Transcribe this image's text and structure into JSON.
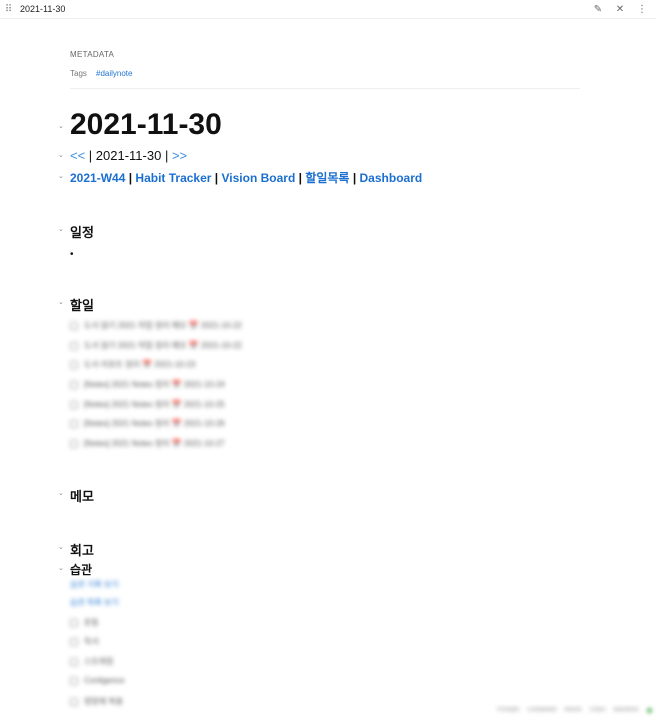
{
  "tab": {
    "title": "2021-11-30"
  },
  "metadata": {
    "title": "METADATA",
    "tags_label": "Tags",
    "tag": "#dailynote"
  },
  "page": {
    "title": "2021-11-30",
    "nav": {
      "prev": "<<",
      "sep1": " | ",
      "current": "2021-11-30",
      "sep2": " | ",
      "next": ">>"
    },
    "links": [
      "2021-W44",
      "Habit Tracker",
      "Vision Board",
      "할일목록",
      "Dashboard"
    ],
    "link_sep": " | "
  },
  "sections": {
    "schedule": "일정",
    "schedule_bullet": "•",
    "todo": "할일",
    "memo": "메모",
    "review": "회고",
    "habit": "습관"
  },
  "todo_items": [
    "도서 읽기 2021 작업 정리 메모 📅 2021-10-22",
    "도서 읽기 2021 작업 정리 메모 📅 2021-10-22",
    "도서 리포트 정리 📅 2021-10-23",
    "[Notes] 2021 Notes 정리 📅 2021-10-24",
    "[Notes] 2021 Notes 정리 📅 2021-10-25",
    "[Notes] 2021 Notes 정리 📅 2021-10-26",
    "[Notes] 2021 Notes 정리 📅 2021-10-27"
  ],
  "habit_links": [
    "습관 기록 보기",
    "습관 목록 보기"
  ],
  "habit_items": [
    "운동",
    "독서",
    "스트레칭",
    "Contigence",
    "영양제 복용"
  ],
  "statusbar": {
    "items": [
      "Prompts",
      "Completed",
      "Words",
      "Chars",
      "Backlinks"
    ]
  }
}
